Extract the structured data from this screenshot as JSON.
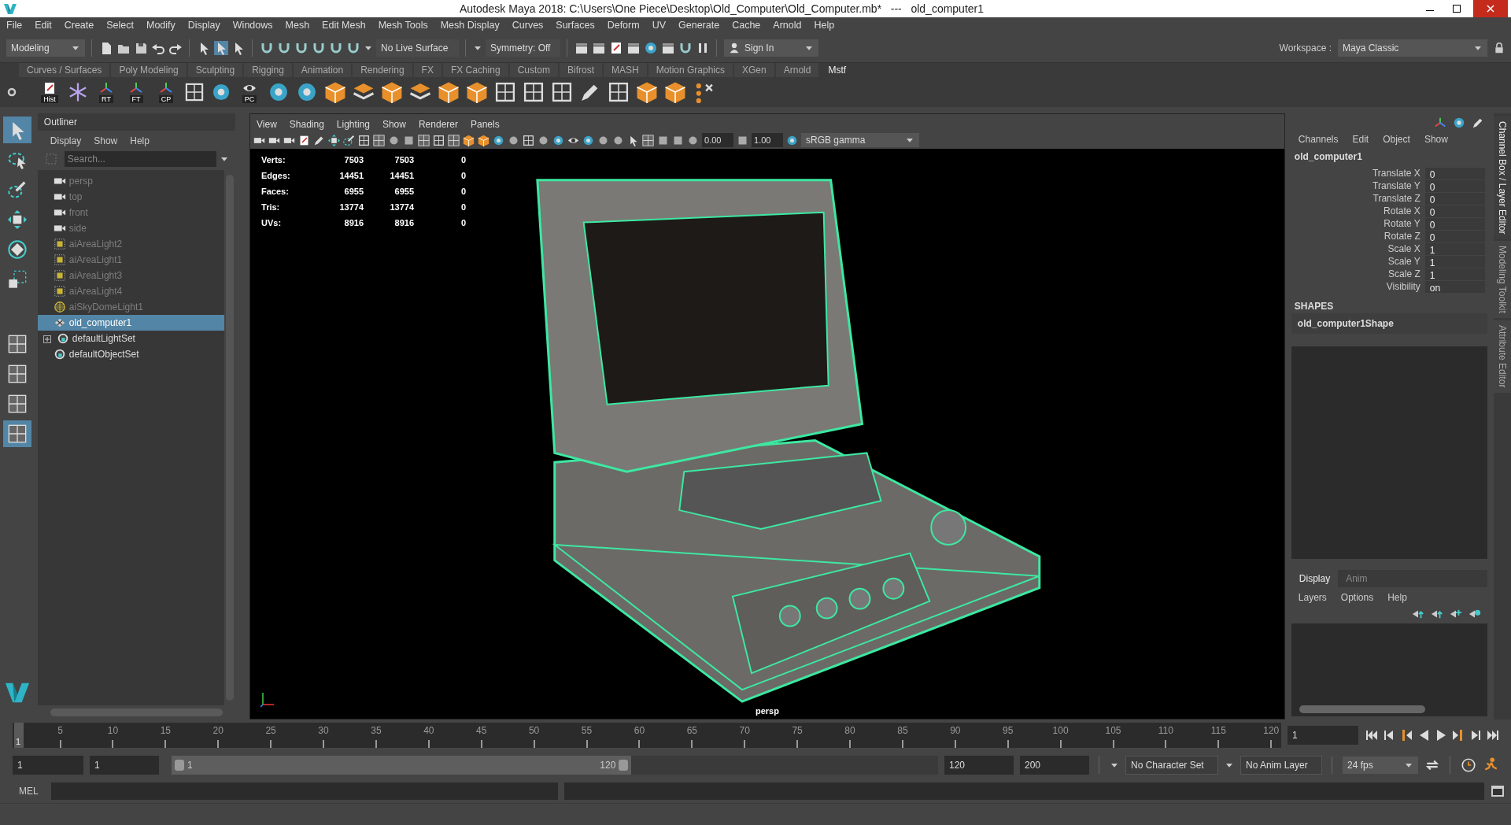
{
  "window": {
    "title": "Autodesk Maya 2018: C:\\Users\\One Piece\\Desktop\\Old_Computer\\Old_Computer.mb*   ---   old_computer1"
  },
  "menu_bar": [
    "File",
    "Edit",
    "Create",
    "Select",
    "Modify",
    "Display",
    "Windows",
    "Mesh",
    "Edit Mesh",
    "Mesh Tools",
    "Mesh Display",
    "Curves",
    "Surfaces",
    "Deform",
    "UV",
    "Generate",
    "Cache",
    "Arnold",
    "Help"
  ],
  "status_line": {
    "mode": "Modeling",
    "live_surface": "No Live Surface",
    "symmetry": "Symmetry: Off",
    "sign_in": "Sign In",
    "workspace_label": "Workspace :",
    "workspace": "Maya Classic"
  },
  "shelf": {
    "tabs": [
      {
        "label": "Curves / Surfaces",
        "selected": false
      },
      {
        "label": "Poly Modeling",
        "selected": false
      },
      {
        "label": "Sculpting",
        "selected": false
      },
      {
        "label": "Rigging",
        "selected": false
      },
      {
        "label": "Animation",
        "selected": false
      },
      {
        "label": "Rendering",
        "selected": false
      },
      {
        "label": "FX",
        "selected": false
      },
      {
        "label": "FX Caching",
        "selected": false
      },
      {
        "label": "Custom",
        "selected": false
      },
      {
        "label": "Bifrost",
        "selected": false
      },
      {
        "label": "MASH",
        "selected": false
      },
      {
        "label": "Motion Graphics",
        "selected": false
      },
      {
        "label": "XGen",
        "selected": false
      },
      {
        "label": "Arnold",
        "selected": false
      },
      {
        "label": "Mstf",
        "selected": true
      }
    ],
    "button_labels": [
      "Hist",
      "RT",
      "FT",
      "CP",
      "PC"
    ]
  },
  "outliner": {
    "title": "Outliner",
    "menu": [
      "Display",
      "Show",
      "Help"
    ],
    "search_placeholder": "Search...",
    "items": [
      {
        "label": "persp",
        "kind": "camera",
        "dimmed": true,
        "selected": false
      },
      {
        "label": "top",
        "kind": "camera",
        "dimmed": true,
        "selected": false
      },
      {
        "label": "front",
        "kind": "camera",
        "dimmed": true,
        "selected": false
      },
      {
        "label": "side",
        "kind": "camera",
        "dimmed": true,
        "selected": false
      },
      {
        "label": "aiAreaLight2",
        "kind": "light",
        "dimmed": true,
        "selected": false
      },
      {
        "label": "aiAreaLight1",
        "kind": "light",
        "dimmed": true,
        "selected": false
      },
      {
        "label": "aiAreaLight3",
        "kind": "light",
        "dimmed": true,
        "selected": false
      },
      {
        "label": "aiAreaLight4",
        "kind": "light",
        "dimmed": true,
        "selected": false
      },
      {
        "label": "aiSkyDomeLight1",
        "kind": "dome",
        "dimmed": true,
        "selected": false
      },
      {
        "label": "old_computer1",
        "kind": "mesh",
        "dimmed": false,
        "selected": true
      },
      {
        "label": "defaultLightSet",
        "kind": "set",
        "dimmed": false,
        "selected": false,
        "expanded": false
      },
      {
        "label": "defaultObjectSet",
        "kind": "set",
        "dimmed": false,
        "selected": false
      }
    ]
  },
  "viewport": {
    "menu": [
      "View",
      "Shading",
      "Lighting",
      "Show",
      "Renderer",
      "Panels"
    ],
    "exposure": "0.00",
    "gamma": "1.00",
    "color_space": "sRGB gamma",
    "hud": [
      {
        "label": "Verts:",
        "values": [
          "7503",
          "7503",
          "0"
        ]
      },
      {
        "label": "Edges:",
        "values": [
          "14451",
          "14451",
          "0"
        ]
      },
      {
        "label": "Faces:",
        "values": [
          "6955",
          "6955",
          "0"
        ]
      },
      {
        "label": "Tris:",
        "values": [
          "13774",
          "13774",
          "0"
        ]
      },
      {
        "label": "UVs:",
        "values": [
          "8916",
          "8916",
          "0"
        ]
      }
    ],
    "camera": "persp"
  },
  "channel_box": {
    "menu": [
      "Channels",
      "Edit",
      "Object",
      "Show"
    ],
    "object": "old_computer1",
    "channels": [
      {
        "name": "Translate X",
        "value": "0"
      },
      {
        "name": "Translate Y",
        "value": "0"
      },
      {
        "name": "Translate Z",
        "value": "0"
      },
      {
        "name": "Rotate X",
        "value": "0"
      },
      {
        "name": "Rotate Y",
        "value": "0"
      },
      {
        "name": "Rotate Z",
        "value": "0"
      },
      {
        "name": "Scale X",
        "value": "1"
      },
      {
        "name": "Scale Y",
        "value": "1"
      },
      {
        "name": "Scale Z",
        "value": "1"
      },
      {
        "name": "Visibility",
        "value": "on"
      }
    ],
    "shapes_heading": "SHAPES",
    "shape": "old_computer1Shape"
  },
  "layer_editor": {
    "tabs": [
      {
        "label": "Display",
        "selected": true
      },
      {
        "label": "Anim",
        "selected": false
      }
    ],
    "menu": [
      "Layers",
      "Options",
      "Help"
    ]
  },
  "side_tabs": [
    {
      "label": "Channel Box / Layer Editor",
      "selected": true
    },
    {
      "label": "Modeling Toolkit",
      "selected": false
    },
    {
      "label": "Attribute Editor",
      "selected": false
    }
  ],
  "timeline": {
    "marker": "1",
    "ticks": [
      "5",
      "10",
      "15",
      "20",
      "25",
      "30",
      "35",
      "40",
      "45",
      "50",
      "55",
      "60",
      "65",
      "70",
      "75",
      "80",
      "85",
      "90",
      "95",
      "100",
      "105",
      "110",
      "115",
      "120"
    ],
    "current_frame": "1"
  },
  "range": {
    "start": "1",
    "playback_start": "1",
    "slider_start": "1",
    "slider_end": "120",
    "level": 0.6,
    "playback_end": "120",
    "end": "200",
    "character_set": "No Character Set",
    "anim_layer": "No Anim Layer",
    "fps": "24 fps"
  },
  "command_line": {
    "label": "MEL"
  }
}
